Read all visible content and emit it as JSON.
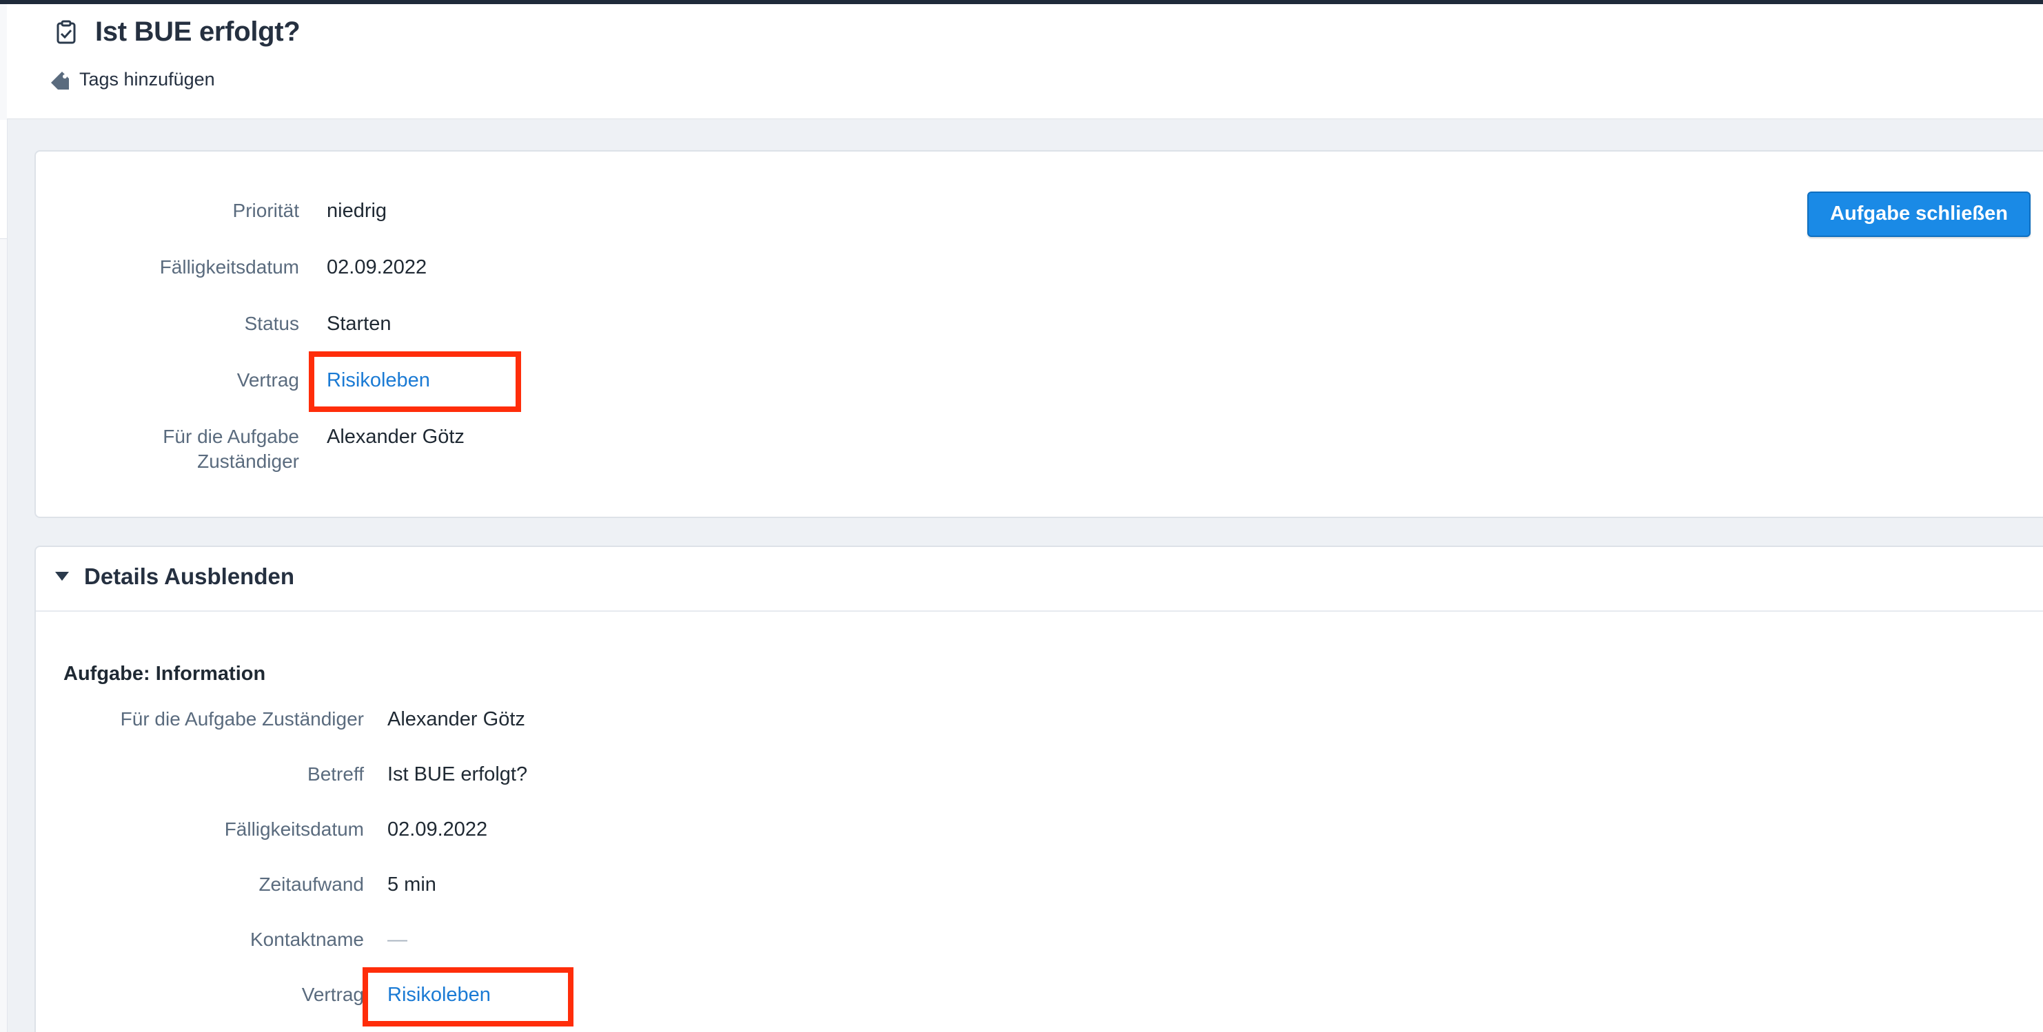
{
  "header": {
    "title": "Ist BUE erfolgt?",
    "tags_label": "Tags hinzufügen"
  },
  "summary": {
    "rows": [
      {
        "label": "Priorität",
        "value": "niedrig"
      },
      {
        "label": "Fälligkeitsdatum",
        "value": "02.09.2022"
      },
      {
        "label": "Status",
        "value": "Starten"
      },
      {
        "label": "Vertrag",
        "value": "Risikoleben"
      },
      {
        "label_line1": "Für die Aufgabe",
        "label_line2": "Zuständiger",
        "value": "Alexander Götz"
      }
    ],
    "close_button": "Aufgabe schließen"
  },
  "details": {
    "toggle_label": "Details Ausblenden",
    "section_title": "Aufgabe: Information",
    "rows": [
      {
        "label": "Für die Aufgabe Zuständiger",
        "value": "Alexander Götz"
      },
      {
        "label": "Betreff",
        "value": "Ist BUE erfolgt?"
      },
      {
        "label": "Fälligkeitsdatum",
        "value": "02.09.2022"
      },
      {
        "label": "Zeitaufwand",
        "value": "5 min"
      },
      {
        "label": "Kontaktname",
        "value": "—"
      },
      {
        "label": "Vertrag",
        "value": "Risikoleben"
      }
    ]
  },
  "colors": {
    "link": "#1a7ad4",
    "primary_button": "#1a8ae6",
    "highlight": "#ff2d0a"
  },
  "icons": [
    "task-checkbox-icon",
    "tag-icon",
    "caret-down-icon"
  ]
}
